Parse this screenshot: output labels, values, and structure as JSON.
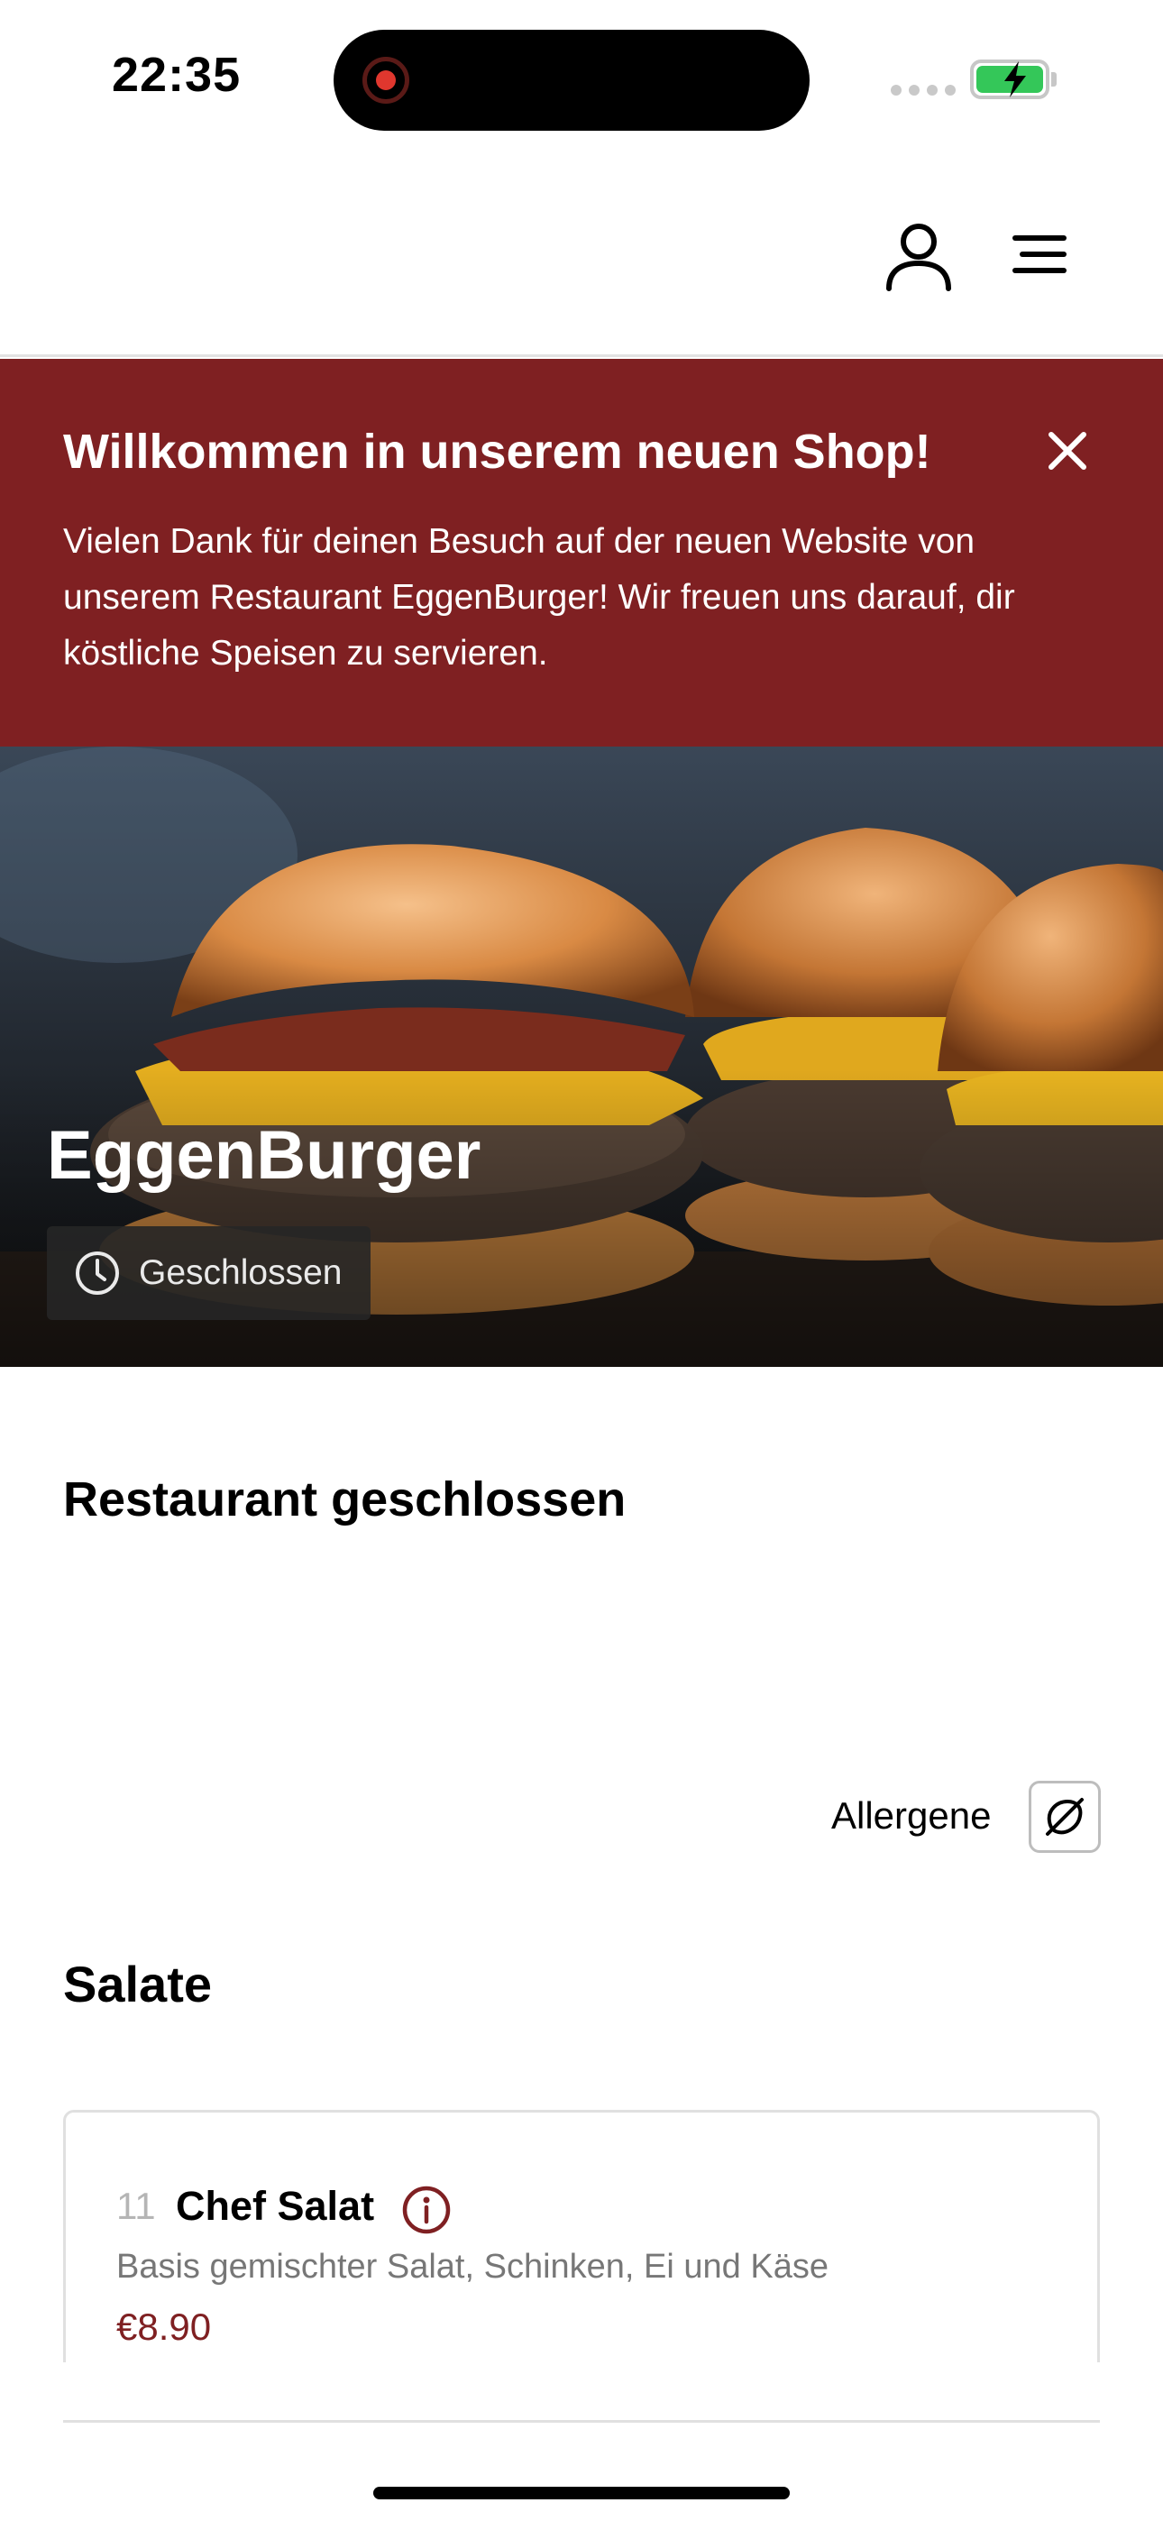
{
  "status_bar": {
    "time": "22:35"
  },
  "banner": {
    "title": "Willkommen in unserem neuen Shop!",
    "text": "Vielen Dank für deinen Besuch auf der neuen Website von unserem Restaurant EggenBurger! Wir freuen uns darauf, dir köstliche Speisen zu servieren."
  },
  "hero": {
    "restaurant_name": "EggenBurger",
    "status": "Geschlossen"
  },
  "notice": {
    "title": "Restaurant geschlossen"
  },
  "allergens": {
    "label": "Allergene"
  },
  "category": {
    "title": "Salate"
  },
  "products": [
    {
      "number": "11",
      "name": "Chef Salat",
      "description": "Basis gemischter Salat, Schinken, Ei und Käse",
      "price": "€8.90"
    }
  ],
  "colors": {
    "brand": "#7f2022",
    "battery": "#34c759",
    "recording": "#e0372e"
  }
}
